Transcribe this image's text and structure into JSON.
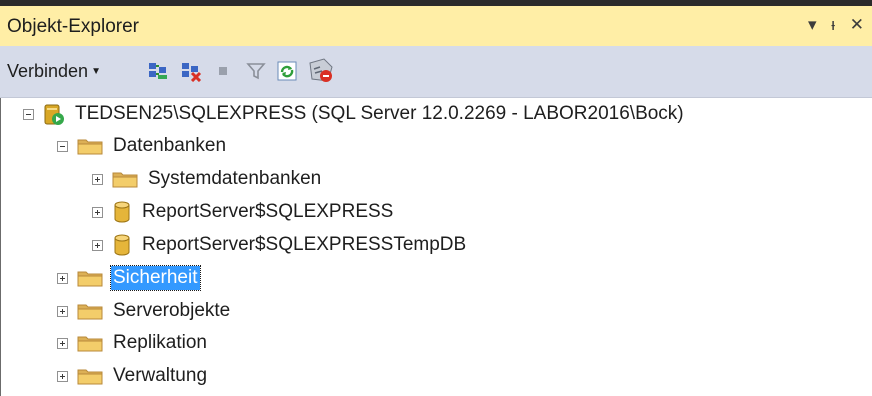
{
  "panel": {
    "title": "Objekt-Explorer",
    "controls": [
      "▾",
      "ᵻ",
      "✕"
    ]
  },
  "toolbar": {
    "connect_label": "Verbinden"
  },
  "tree": {
    "server": "TEDSEN25\\SQLEXPRESS (SQL Server 12.0.2269 - LABOR2016\\Bock)",
    "datenbanken": "Datenbanken",
    "systemdatenbanken": "Systemdatenbanken",
    "reportserver": "ReportServer$SQLEXPRESS",
    "reportserver_temp": "ReportServer$SQLEXPRESSTempDB",
    "sicherheit": "Sicherheit",
    "serverobjekte": "Serverobjekte",
    "replikation": "Replikation",
    "verwaltung": "Verwaltung"
  },
  "colors": {
    "titlebar": "#ffeea6",
    "toolbar": "#d6dbe9",
    "selection": "#3399ff"
  }
}
